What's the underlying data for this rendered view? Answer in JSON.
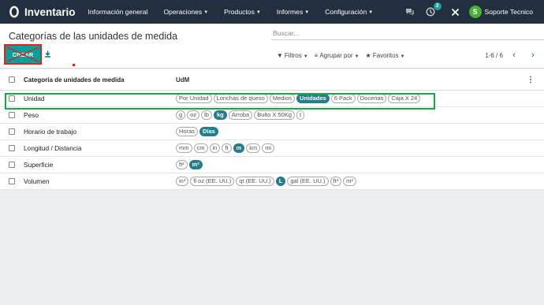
{
  "topbar": {
    "app_name": "Inventario",
    "menu": [
      {
        "label": "Información general",
        "has_caret": false
      },
      {
        "label": "Operaciones",
        "has_caret": true
      },
      {
        "label": "Productos",
        "has_caret": true
      },
      {
        "label": "Informes",
        "has_caret": true
      },
      {
        "label": "Configuración",
        "has_caret": true
      }
    ],
    "activity_badge": "2",
    "user_initial": "S",
    "user_name": "Soporte Tecnico"
  },
  "control": {
    "title": "Categorías de las unidades de medida",
    "search_placeholder": "Buscar...",
    "create_label": "CREAR",
    "filters": [
      {
        "icon": "filter-icon",
        "label": "Filtros"
      },
      {
        "icon": "group-icon",
        "label": "Agrupar por"
      },
      {
        "icon": "star-icon",
        "label": "Favoritos"
      }
    ],
    "pager": "1-6 / 6"
  },
  "table": {
    "headers": {
      "name": "Categoría de unidades de medida",
      "udm": "UdM"
    },
    "rows": [
      {
        "name": "Unidad",
        "tags": [
          {
            "label": "Por Unidad",
            "selected": false
          },
          {
            "label": "Lonchas de queso",
            "selected": false
          },
          {
            "label": "Medios",
            "selected": false
          },
          {
            "label": "Unidades",
            "selected": true
          },
          {
            "label": "6 Pack",
            "selected": false
          },
          {
            "label": "Docenas",
            "selected": false
          },
          {
            "label": "Caja X 24",
            "selected": false
          }
        ]
      },
      {
        "name": "Peso",
        "tags": [
          {
            "label": "g",
            "selected": false
          },
          {
            "label": "oz",
            "selected": false
          },
          {
            "label": "lb",
            "selected": false
          },
          {
            "label": "kg",
            "selected": true
          },
          {
            "label": "Arroba",
            "selected": false
          },
          {
            "label": "Bulto X 50Kg",
            "selected": false
          },
          {
            "label": "t",
            "selected": false
          }
        ]
      },
      {
        "name": "Horario de trabajo",
        "tags": [
          {
            "label": "Horas",
            "selected": false
          },
          {
            "label": "Días",
            "selected": true
          }
        ]
      },
      {
        "name": "Longitud / Distancia",
        "tags": [
          {
            "label": "mm",
            "selected": false
          },
          {
            "label": "cm",
            "selected": false
          },
          {
            "label": "in",
            "selected": false
          },
          {
            "label": "ft",
            "selected": false
          },
          {
            "label": "m",
            "selected": true
          },
          {
            "label": "km",
            "selected": false
          },
          {
            "label": "mi",
            "selected": false
          }
        ]
      },
      {
        "name": "Superficie",
        "tags": [
          {
            "label": "ft²",
            "selected": false
          },
          {
            "label": "m²",
            "selected": true
          }
        ]
      },
      {
        "name": "Volumen",
        "tags": [
          {
            "label": "in³",
            "selected": false
          },
          {
            "label": "fl oz (EE. UU.)",
            "selected": false
          },
          {
            "label": "qt (EE. UU.)",
            "selected": false
          },
          {
            "label": "L",
            "selected": true
          },
          {
            "label": "gal (EE. UU.)",
            "selected": false
          },
          {
            "label": "ft³",
            "selected": false
          },
          {
            "label": "m³",
            "selected": false
          }
        ]
      }
    ]
  },
  "colors": {
    "topbar": "#212f3e",
    "primary": "#00a09d",
    "tag_selected": "#257d8c",
    "highlight": "#1ba548",
    "annotation": "#e2231a"
  }
}
